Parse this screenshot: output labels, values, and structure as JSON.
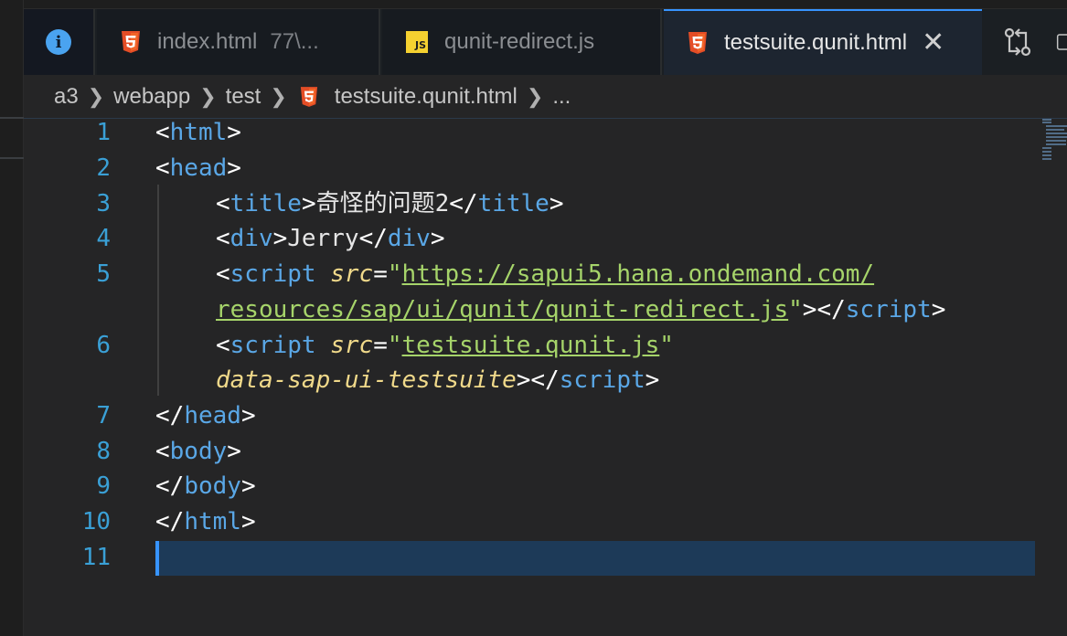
{
  "tabs": [
    {
      "label": "index.html",
      "sub": "77\\...",
      "icon": "html5-icon"
    },
    {
      "label": "qunit-redirect.js",
      "icon": "js-icon"
    },
    {
      "label": "testsuite.qunit.html",
      "icon": "html5-icon",
      "active": true
    }
  ],
  "breadcrumb": {
    "items": [
      "a3",
      "webapp",
      "test",
      "testsuite.qunit.html",
      "..."
    ]
  },
  "editor": {
    "line_numbers": [
      "1",
      "2",
      "3",
      "4",
      "5",
      "6",
      "7",
      "8",
      "9",
      "10",
      "11"
    ],
    "code": {
      "l1": {
        "open": "<",
        "tag": "html",
        "close": ">"
      },
      "l2": {
        "open": "<",
        "tag": "head",
        "close": ">"
      },
      "l3": {
        "open": "<",
        "tag": "title",
        "close": ">",
        "text": "奇怪的问题2",
        "end_open": "</",
        "end_tag": "title",
        "end_close": ">"
      },
      "l4": {
        "open": "<",
        "tag": "div",
        "close": ">",
        "text": "Jerry",
        "end_open": "</",
        "end_tag": "div",
        "end_close": ">"
      },
      "l5": {
        "open": "<",
        "tag": "script",
        "attr": "src",
        "eq": "=",
        "quote": "\"",
        "url_part1": "https://sapui5.hana.ondemand.com/"
      },
      "l5b": {
        "url_part2": "resources/sap/ui/qunit/qunit-redirect.js",
        "quote": "\"",
        "close": ">",
        "end_open": "</",
        "end_tag": "script",
        "end_close": ">"
      },
      "l6": {
        "open": "<",
        "tag": "script",
        "attr": "src",
        "eq": "=",
        "quote": "\"",
        "url": "testsuite.qunit.js",
        "quote2": "\""
      },
      "l6b": {
        "attr": "data-sap-ui-testsuite",
        "close": ">",
        "end_open": "</",
        "end_tag": "script",
        "end_close": ">"
      },
      "l7": {
        "open": "</",
        "tag": "head",
        "close": ">"
      },
      "l8": {
        "open": "<",
        "tag": "body",
        "close": ">"
      },
      "l9": {
        "open": "</",
        "tag": "body",
        "close": ">"
      },
      "l10": {
        "open": "</",
        "tag": "html",
        "close": ">"
      }
    }
  },
  "colors": {
    "tag": "#5aa7e6",
    "attribute": "#f0d98a",
    "string": "#a6d46a",
    "line_number": "#3aa0d6",
    "active_tab_border": "#3794ff",
    "current_line": "#1d3a58"
  },
  "icons": [
    "info-icon",
    "html5-icon",
    "js-icon",
    "close-icon",
    "compare-changes-icon",
    "split-editor-icon",
    "chevron-right-icon"
  ]
}
